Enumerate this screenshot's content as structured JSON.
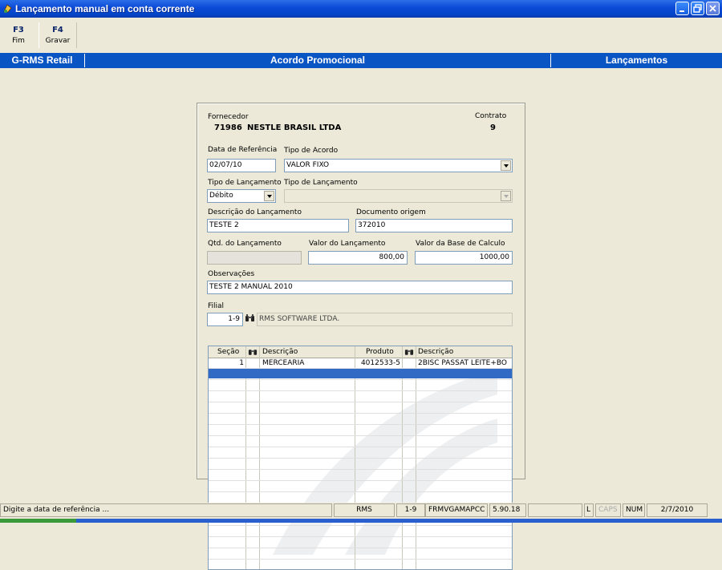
{
  "window": {
    "title": "Lançamento manual em conta corrente"
  },
  "toolbar": {
    "buttons": [
      {
        "key": "F3",
        "label": "Fim"
      },
      {
        "key": "F4",
        "label": "Gravar"
      }
    ]
  },
  "header": {
    "app": "G-RMS Retail",
    "module": "Acordo Promocional",
    "section": "Lançamentos"
  },
  "form": {
    "fornecedor_label": "Fornecedor",
    "fornecedor_code": "71986",
    "fornecedor_name": "NESTLE BRASIL LTDA",
    "contrato_label": "Contrato",
    "contrato_value": "9",
    "data_ref_label": "Data de Referência",
    "data_ref_value": "02/07/10",
    "tipo_acordo_label": "Tipo de  Acordo",
    "tipo_acordo_value": "VALOR FIXO",
    "tipo_lanc1_label": "Tipo de Lançamento",
    "tipo_lanc1_value": "Débito",
    "tipo_lanc2_label": "Tipo de Lançamento",
    "tipo_lanc2_value": "",
    "descricao_label": "Descrição do Lançamento",
    "descricao_value": "TESTE 2",
    "documento_label": "Documento origem",
    "documento_value": "372010",
    "qtd_label": "Qtd. do Lançamento",
    "qtd_value": "",
    "valor_label": "Valor do Lançamento",
    "valor_value": "800,00",
    "base_label": "Valor da Base de Calculo",
    "base_value": "1000,00",
    "obs_label": "Observações",
    "obs_value": "TESTE 2  MANUAL 2010",
    "filial_label": "Filial",
    "filial_code": "1-9",
    "filial_name": "RMS SOFTWARE LTDA."
  },
  "grid": {
    "headers": [
      "Seção",
      "Descrição",
      "Produto",
      "Descrição"
    ],
    "rows": [
      {
        "secao": "1",
        "descricao": "MERCEARIA",
        "produto": "4012533-5",
        "prod_desc": "2BISC PASSAT LEITE+BO"
      }
    ]
  },
  "statusbar": {
    "message": "Digite a data de referência ...",
    "user": "RMS",
    "filial": "1-9",
    "program": "FRMVGAMAPCC",
    "version": "5.90.18",
    "l": "L",
    "caps": "CAPS",
    "num": "NUM",
    "date": "2/7/2010"
  },
  "colors": {
    "title_bar": "#0a49d6",
    "header_bar": "#0a55c4",
    "selected_row": "#316ac5",
    "background": "#ece9d8"
  }
}
